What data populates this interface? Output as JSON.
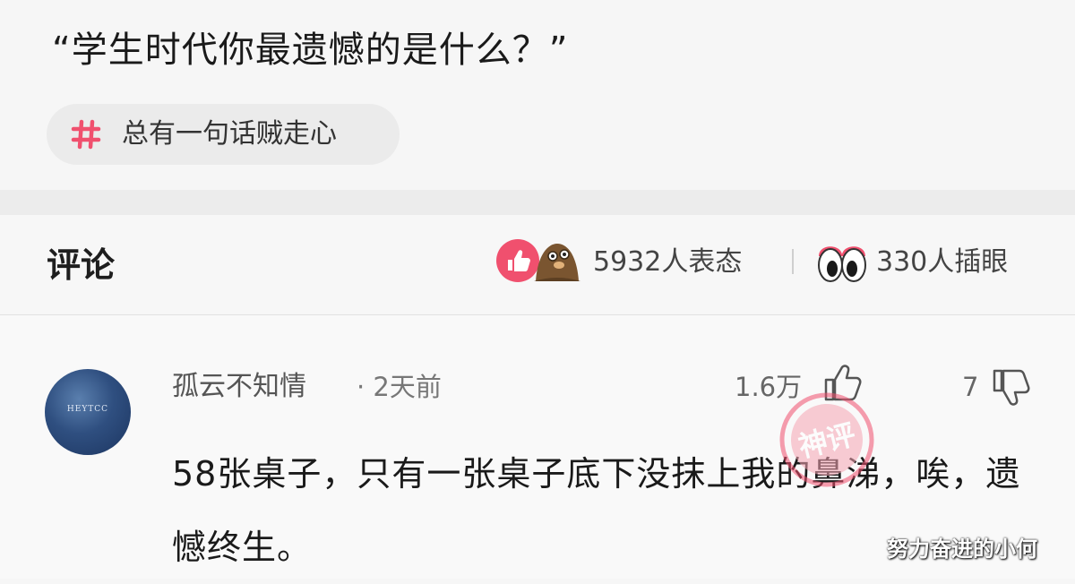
{
  "post": {
    "question": "“学生时代你最遗憾的是什么？”",
    "topic_tag": "总有一句话贼走心"
  },
  "comments_header": {
    "title": "评论",
    "reactions_text": "5932人表态",
    "eyes_text": "330人插眼"
  },
  "comment": {
    "username": "孤云不知情",
    "time_ago": "· 2天前",
    "avatar_text": "HEYTCC",
    "like_count": "1.6万",
    "dislike_count": "7",
    "body": "58张桌子，只有一张桌子底下没抹上我的鼻涕，唉，遗憾终生。"
  },
  "stamp_text": "神评",
  "watermark": "努力奋进的小何",
  "colors": {
    "accent_pink": "#f0506e",
    "background": "#f6f6f6",
    "text_primary": "#1a1a1a",
    "text_secondary": "#777777"
  },
  "icons": {
    "topic": "hash-icon",
    "reaction_1": "thumbs-up-icon",
    "reaction_2": "mole-emoji-icon",
    "eyes": "eyes-icon",
    "like": "thumb-up-outline-icon",
    "dislike": "thumb-down-outline-icon"
  }
}
